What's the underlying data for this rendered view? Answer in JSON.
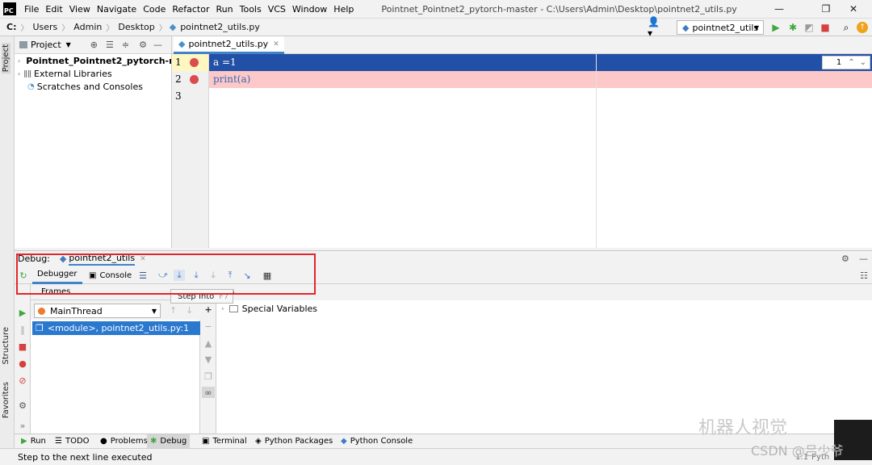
{
  "menubar": {
    "logo": "PC",
    "items": [
      "File",
      "Edit",
      "View",
      "Navigate",
      "Code",
      "Refactor",
      "Run",
      "Tools",
      "VCS",
      "Window",
      "Help"
    ],
    "title": "Pointnet_Pointnet2_pytorch-master - C:\\Users\\Admin\\Desktop\\pointnet2_utils.py"
  },
  "breadcrumb": {
    "drive": "C:",
    "items": [
      "Users",
      "Admin",
      "Desktop",
      "pointnet2_utils.py"
    ]
  },
  "run_config": {
    "label": "pointnet2_utils"
  },
  "project": {
    "header": "Project",
    "tree": [
      {
        "label": "Pointnet_Pointnet2_pytorch-mast",
        "bold": true
      },
      {
        "label": "External Libraries"
      },
      {
        "label": "Scratches and Consoles"
      }
    ]
  },
  "editor": {
    "tab": "pointnet2_utils.py",
    "lines": [
      {
        "num": "1",
        "code": "a =1"
      },
      {
        "num": "2",
        "code": "print(a)"
      },
      {
        "num": "3",
        "code": ""
      }
    ],
    "find_count": "1"
  },
  "debug": {
    "title": "Debug:",
    "config": "pointnet2_utils",
    "tabs": {
      "debugger": "Debugger",
      "console": "Console"
    },
    "frames_header": "Frames",
    "vars_header": "es",
    "tooltip": {
      "label": "Step Into",
      "shortcut": "F7"
    },
    "thread": "MainThread",
    "frame": "<module>, pointnet2_utils.py:1",
    "variables": "Special Variables"
  },
  "sidebar": {
    "project": "Project",
    "structure": "Structure",
    "favorites": "Favorites"
  },
  "bottom_tabs": [
    "Run",
    "TODO",
    "Problems",
    "Debug",
    "Terminal",
    "Python Packages",
    "Python Console"
  ],
  "status": {
    "text": "Step to the next line executed",
    "right": "1:1",
    "right2": "Pyth"
  },
  "watermark": {
    "line1": "机器人视觉",
    "line2": "CSDN @吕少爷"
  },
  "colors": {
    "current_line": "#2250a6",
    "breakpoint_line": "#fcc8c8",
    "breakpoint": "#db4c4c",
    "selection": "#2b78cf",
    "highlight_box": "#e3262b"
  }
}
